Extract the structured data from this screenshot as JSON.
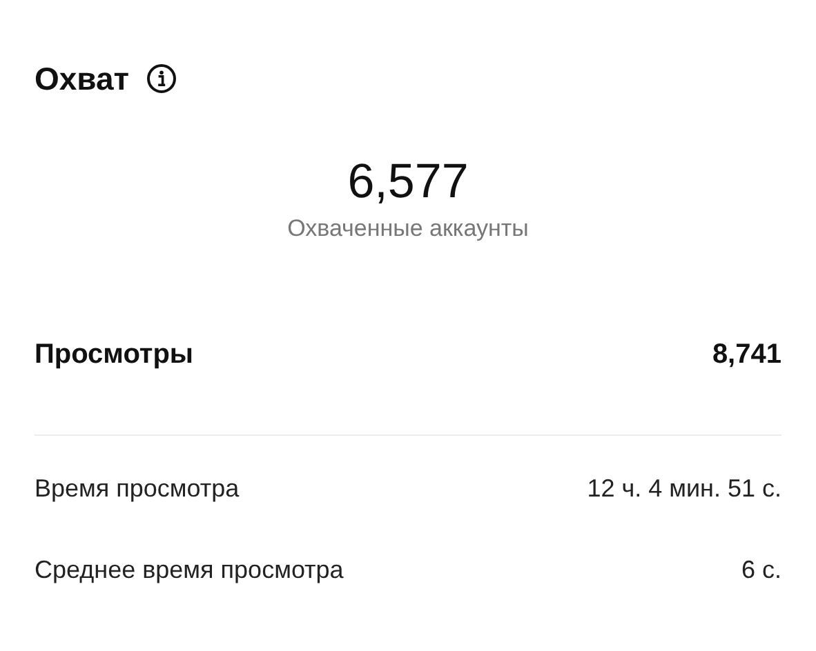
{
  "header": {
    "title": "Охват"
  },
  "summary": {
    "value": "6,577",
    "label": "Охваченные аккаунты"
  },
  "views": {
    "label": "Просмотры",
    "value": "8,741"
  },
  "details": [
    {
      "label": "Время просмотра",
      "value": "12 ч. 4 мин. 51 с."
    },
    {
      "label": "Среднее время просмотра",
      "value": "6 с."
    }
  ]
}
